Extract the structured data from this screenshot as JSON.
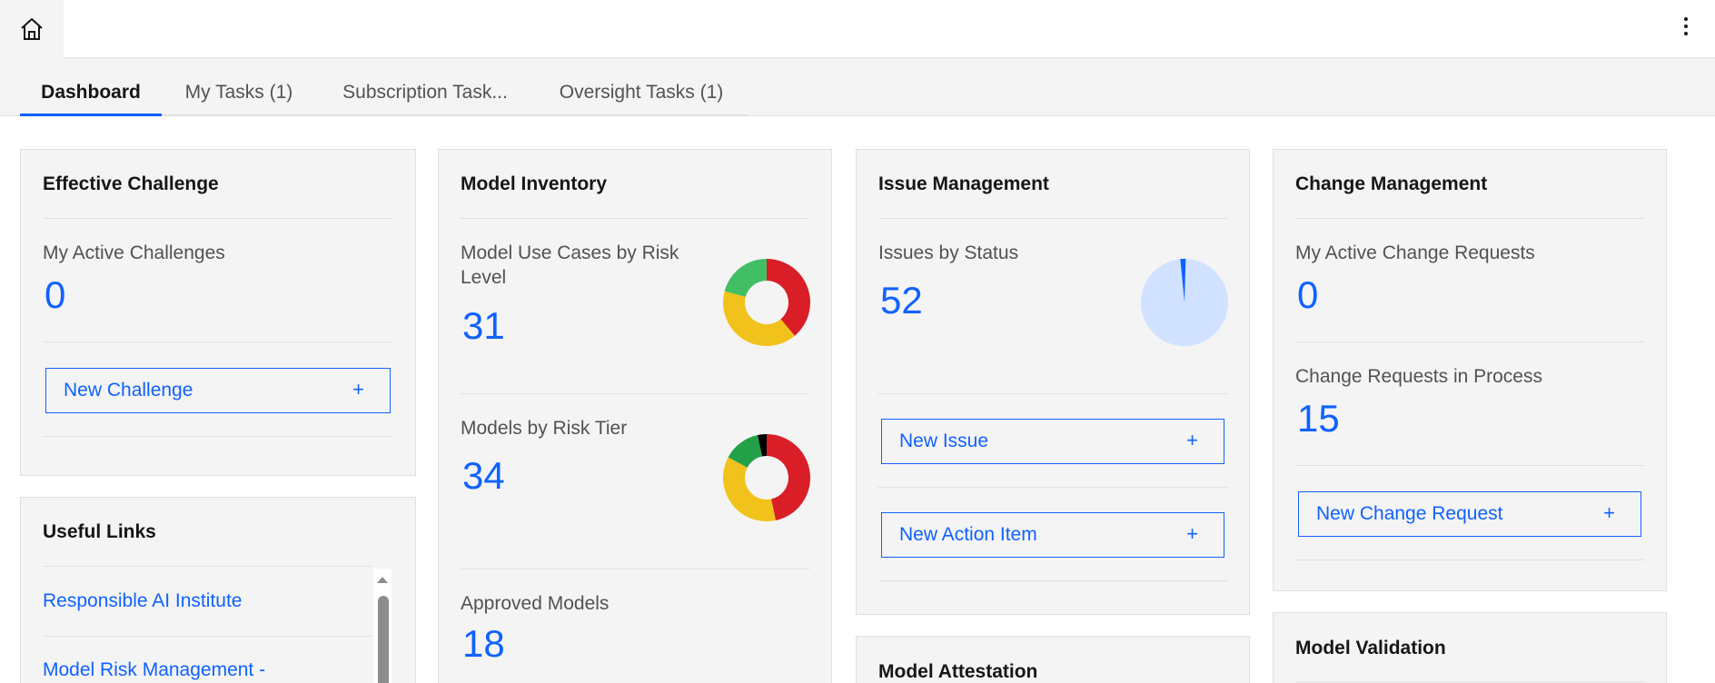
{
  "header": {
    "home_icon": "home-icon",
    "overflow_icon": "overflow-menu-vertical-icon"
  },
  "tabs": [
    {
      "label": "Dashboard",
      "active": true
    },
    {
      "label": "My Tasks (1)",
      "active": false
    },
    {
      "label": "Subscription Task...",
      "active": false
    },
    {
      "label": "Oversight Tasks (1)",
      "active": false
    }
  ],
  "colors": {
    "accent": "#0f62fe",
    "red": "#da1e28",
    "yellow": "#f1c21b",
    "green": "#24a148",
    "light_green": "#42be65",
    "black": "#000000",
    "pie_light": "#d0e2ff"
  },
  "effective_challenge": {
    "title": "Effective Challenge",
    "metric_label": "My Active Challenges",
    "metric_value": "0",
    "button_label": "New Challenge",
    "button_icon": "+"
  },
  "useful_links": {
    "title": "Useful Links",
    "links": [
      "Responsible AI Institute",
      "Model Risk Management -"
    ]
  },
  "model_inventory": {
    "title": "Model Inventory",
    "metrics": [
      {
        "label": "Model Use Cases by Risk Level",
        "value": "31"
      },
      {
        "label": "Models by Risk Tier",
        "value": "34"
      },
      {
        "label": "Approved Models",
        "value": "18"
      }
    ]
  },
  "issue_management": {
    "title": "Issue Management",
    "metric_label": "Issues by Status",
    "metric_value": "52",
    "buttons": [
      {
        "label": "New Issue",
        "icon": "+"
      },
      {
        "label": "New Action Item",
        "icon": "+"
      }
    ]
  },
  "model_attestation": {
    "title": "Model Attestation"
  },
  "change_management": {
    "title": "Change Management",
    "metrics": [
      {
        "label": "My Active Change Requests",
        "value": "0"
      },
      {
        "label": "Change Requests in Process",
        "value": "15"
      }
    ],
    "button_label": "New Change Request",
    "button_icon": "+"
  },
  "model_validation": {
    "title": "Model Validation"
  }
}
